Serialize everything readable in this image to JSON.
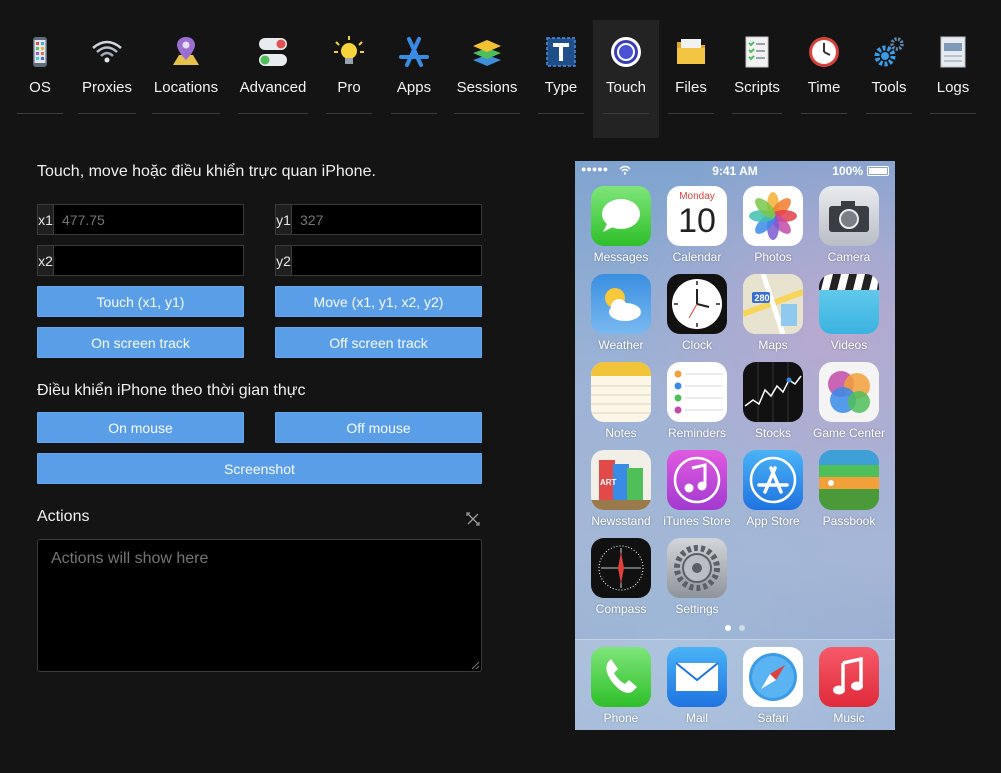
{
  "nav": {
    "items": [
      {
        "label": "OS",
        "icon": "phone-os-icon"
      },
      {
        "label": "Proxies",
        "icon": "wifi-icon"
      },
      {
        "label": "Locations",
        "icon": "map-pin-icon"
      },
      {
        "label": "Advanced",
        "icon": "toggle-icon"
      },
      {
        "label": "Pro",
        "icon": "lightbulb-icon"
      },
      {
        "label": "Apps",
        "icon": "app-store-icon"
      },
      {
        "label": "Sessions",
        "icon": "layers-icon"
      },
      {
        "label": "Type",
        "icon": "text-type-icon"
      },
      {
        "label": "Touch",
        "icon": "touch-target-icon"
      },
      {
        "label": "Files",
        "icon": "folder-icon"
      },
      {
        "label": "Scripts",
        "icon": "checklist-icon"
      },
      {
        "label": "Time",
        "icon": "clock-icon"
      },
      {
        "label": "Tools",
        "icon": "gears-icon"
      },
      {
        "label": "Logs",
        "icon": "log-file-icon"
      }
    ],
    "active": "Touch"
  },
  "touch": {
    "intro": "Touch, move hoặc điều khiển trực quan iPhone.",
    "x1_label": "x1",
    "x1_value": "",
    "x1_placeholder": "477.75",
    "y1_label": "y1",
    "y1_value": "",
    "y1_placeholder": "327",
    "x2_label": "x2",
    "x2_value": "",
    "x2_placeholder": "",
    "y2_label": "y2",
    "y2_value": "",
    "y2_placeholder": "",
    "touch_button": "Touch (x1, y1)",
    "move_button": "Move (x1, y1, x2, y2)",
    "on_track_button": "On screen track",
    "off_track_button": "Off screen track",
    "realtime_title": "Điều khiển iPhone theo thời gian thực",
    "on_mouse_button": "On mouse",
    "off_mouse_button": "Off mouse",
    "screenshot_button": "Screenshot",
    "actions_title": "Actions",
    "actions_placeholder": "Actions will show here"
  },
  "phone": {
    "status": {
      "signal": "●●●●●",
      "time": "9:41 AM",
      "battery": "100%"
    },
    "calendar": {
      "weekday": "Monday",
      "day": "10"
    },
    "apps": [
      {
        "name": "Messages",
        "icon": "messages-icon"
      },
      {
        "name": "Calendar",
        "icon": "calendar-icon"
      },
      {
        "name": "Photos",
        "icon": "photos-icon"
      },
      {
        "name": "Camera",
        "icon": "camera-icon"
      },
      {
        "name": "Weather",
        "icon": "weather-icon"
      },
      {
        "name": "Clock",
        "icon": "clock-app-icon"
      },
      {
        "name": "Maps",
        "icon": "maps-icon"
      },
      {
        "name": "Videos",
        "icon": "videos-icon"
      },
      {
        "name": "Notes",
        "icon": "notes-icon"
      },
      {
        "name": "Reminders",
        "icon": "reminders-icon"
      },
      {
        "name": "Stocks",
        "icon": "stocks-icon"
      },
      {
        "name": "Game Center",
        "icon": "game-center-icon"
      },
      {
        "name": "Newsstand",
        "icon": "newsstand-icon"
      },
      {
        "name": "iTunes Store",
        "icon": "itunes-icon"
      },
      {
        "name": "App Store",
        "icon": "app-store-app-icon"
      },
      {
        "name": "Passbook",
        "icon": "passbook-icon"
      },
      {
        "name": "Compass",
        "icon": "compass-icon"
      },
      {
        "name": "Settings",
        "icon": "settings-icon"
      }
    ],
    "dock": [
      {
        "name": "Phone",
        "icon": "phone-call-icon"
      },
      {
        "name": "Mail",
        "icon": "mail-icon"
      },
      {
        "name": "Safari",
        "icon": "safari-icon"
      },
      {
        "name": "Music",
        "icon": "music-icon"
      }
    ],
    "maps_badge": "280",
    "newsstand_text": "ART"
  },
  "colors": {
    "accent": "#5b9ee8",
    "background": "#141414",
    "active_tab": "#232323"
  }
}
